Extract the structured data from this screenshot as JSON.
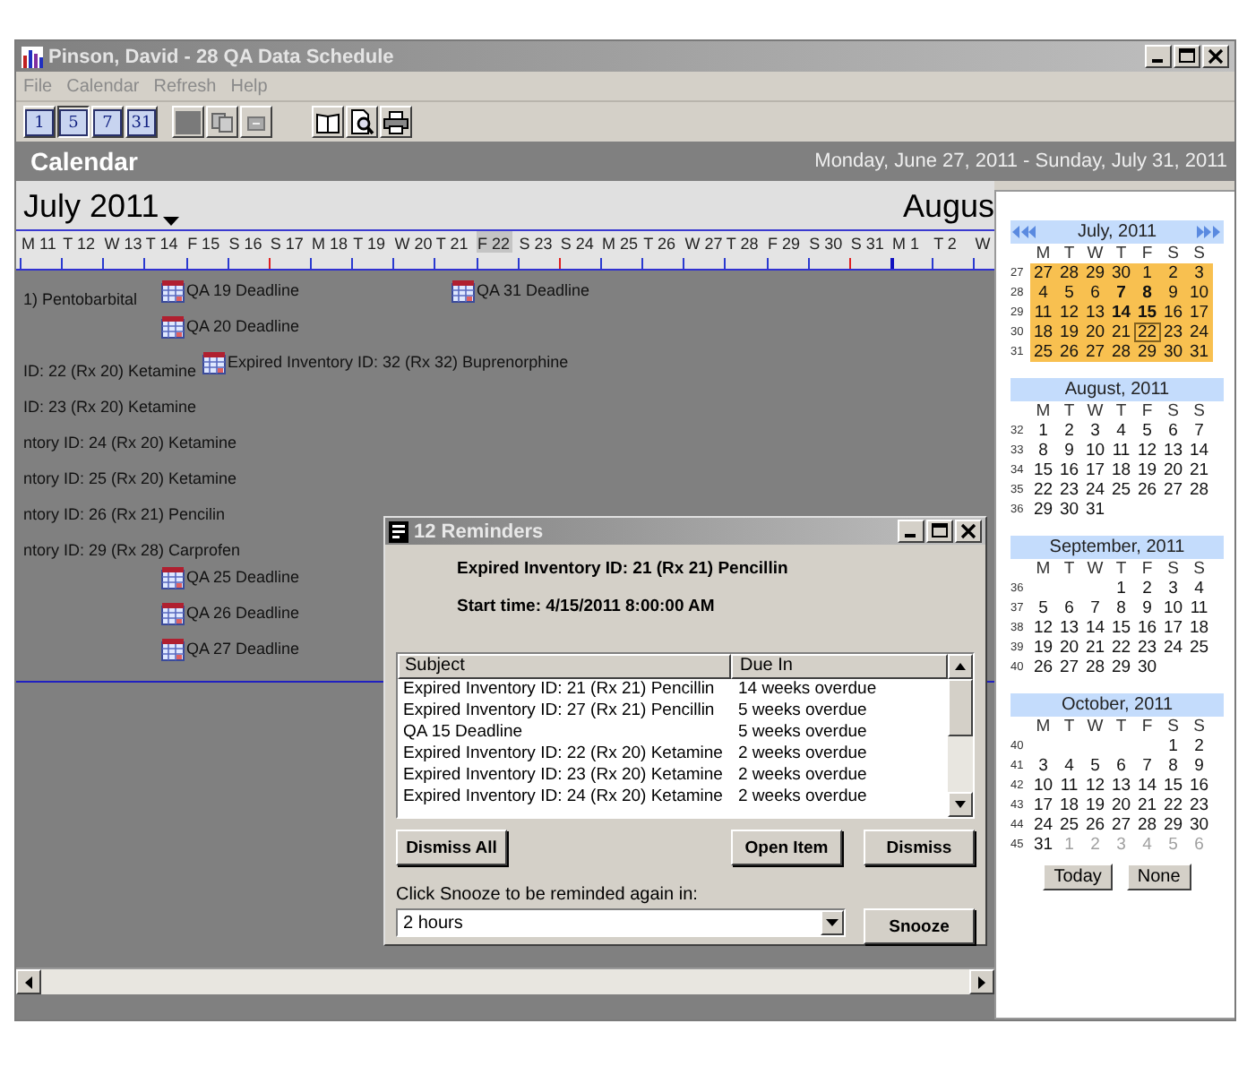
{
  "window": {
    "title": "Pinson, David - 28 QA Data Schedule"
  },
  "menu": [
    "File",
    "Calendar",
    "Refresh",
    "Help"
  ],
  "toolbar": {
    "view_buttons": [
      {
        "label": "1",
        "selected": false
      },
      {
        "label": "5",
        "selected": true
      },
      {
        "label": "7",
        "selected": false
      },
      {
        "label": "31",
        "selected": false
      }
    ]
  },
  "header": {
    "title": "Calendar",
    "range": "Monday, June 27, 2011 - Sunday, July 31, 2011"
  },
  "timeline": {
    "month": "July 2011",
    "next_month": "Augus",
    "days": [
      {
        "label": "M 11",
        "kind": "weekday",
        "selected": false
      },
      {
        "label": "T 12",
        "kind": "weekday",
        "selected": false
      },
      {
        "label": "W 13",
        "kind": "weekday",
        "selected": false
      },
      {
        "label": "T 14",
        "kind": "weekday",
        "selected": false
      },
      {
        "label": "F 15",
        "kind": "weekday",
        "selected": false
      },
      {
        "label": "S 16",
        "kind": "weekday",
        "selected": false
      },
      {
        "label": "S 17",
        "kind": "sunday",
        "selected": false
      },
      {
        "label": "M 18",
        "kind": "weekday",
        "selected": false
      },
      {
        "label": "T 19",
        "kind": "weekday",
        "selected": false
      },
      {
        "label": "W 20",
        "kind": "weekday",
        "selected": false
      },
      {
        "label": "T 21",
        "kind": "weekday",
        "selected": false
      },
      {
        "label": "F 22",
        "kind": "weekday",
        "selected": true
      },
      {
        "label": "S 23",
        "kind": "weekday",
        "selected": false
      },
      {
        "label": "S 24",
        "kind": "sunday",
        "selected": false
      },
      {
        "label": "M 25",
        "kind": "weekday",
        "selected": false
      },
      {
        "label": "T 26",
        "kind": "weekday",
        "selected": false
      },
      {
        "label": "W 27",
        "kind": "weekday",
        "selected": false
      },
      {
        "label": "T 28",
        "kind": "weekday",
        "selected": false
      },
      {
        "label": "F 29",
        "kind": "weekday",
        "selected": false
      },
      {
        "label": "S 30",
        "kind": "weekday",
        "selected": false
      },
      {
        "label": "S 31",
        "kind": "sunday",
        "selected": false
      },
      {
        "label": "M 1",
        "kind": "month_start",
        "selected": false
      },
      {
        "label": "T 2",
        "kind": "weekday",
        "selected": false
      },
      {
        "label": "W",
        "kind": "weekday",
        "selected": false
      }
    ],
    "rows": [
      {
        "events": [
          {
            "text": "1) Pentobarbital",
            "kind": "continued"
          },
          {
            "text": "QA 19 Deadline",
            "kind": "appointment"
          },
          {
            "text": "QA 31 Deadline",
            "kind": "appointment"
          }
        ]
      },
      {
        "events": [
          {
            "text": "QA 20 Deadline",
            "kind": "appointment"
          }
        ]
      },
      {
        "events": [
          {
            "text": "ID: 22 (Rx 20) Ketamine",
            "kind": "continued"
          },
          {
            "text": "Expired Inventory ID: 32 (Rx 32) Buprenorphine",
            "kind": "appointment"
          }
        ]
      },
      {
        "events": [
          {
            "text": "ID: 23 (Rx 20) Ketamine",
            "kind": "continued"
          }
        ]
      },
      {
        "events": [
          {
            "text": "ntory ID: 24 (Rx 20) Ketamine",
            "kind": "continued"
          }
        ]
      },
      {
        "events": [
          {
            "text": "ntory ID: 25 (Rx 20) Ketamine",
            "kind": "continued"
          }
        ]
      },
      {
        "events": [
          {
            "text": "ntory ID: 26 (Rx 21) Pencilin",
            "kind": "continued"
          }
        ]
      },
      {
        "events": [
          {
            "text": "ntory ID: 29 (Rx 28) Carprofen",
            "kind": "continued"
          }
        ]
      },
      {
        "events": [
          {
            "text": "QA 25 Deadline",
            "kind": "appointment"
          }
        ]
      },
      {
        "events": [
          {
            "text": "QA 26 Deadline",
            "kind": "appointment"
          }
        ]
      },
      {
        "events": [
          {
            "text": "QA 27 Deadline",
            "kind": "appointment"
          }
        ]
      }
    ]
  },
  "mini_calendar": {
    "months": [
      {
        "title": "July, 2011",
        "highlighted": true,
        "navigation": true,
        "weekdays": [
          "M",
          "T",
          "W",
          "T",
          "F",
          "S",
          "S"
        ],
        "weeks": [
          {
            "number": "27",
            "days": [
              {
                "day": "27",
                "kind": "normal"
              },
              {
                "day": "28",
                "kind": "normal"
              },
              {
                "day": "29",
                "kind": "normal"
              },
              {
                "day": "30",
                "kind": "normal"
              },
              {
                "day": "1",
                "kind": "normal"
              },
              {
                "day": "2",
                "kind": "normal"
              },
              {
                "day": "3",
                "kind": "normal"
              }
            ]
          },
          {
            "number": "28",
            "days": [
              {
                "day": "4",
                "kind": "normal"
              },
              {
                "day": "5",
                "kind": "normal"
              },
              {
                "day": "6",
                "kind": "normal"
              },
              {
                "day": "7",
                "kind": "bold"
              },
              {
                "day": "8",
                "kind": "bold"
              },
              {
                "day": "9",
                "kind": "normal"
              },
              {
                "day": "10",
                "kind": "normal"
              }
            ]
          },
          {
            "number": "29",
            "days": [
              {
                "day": "11",
                "kind": "normal"
              },
              {
                "day": "12",
                "kind": "normal"
              },
              {
                "day": "13",
                "kind": "normal"
              },
              {
                "day": "14",
                "kind": "bold"
              },
              {
                "day": "15",
                "kind": "bold"
              },
              {
                "day": "16",
                "kind": "normal"
              },
              {
                "day": "17",
                "kind": "normal"
              }
            ]
          },
          {
            "number": "30",
            "days": [
              {
                "day": "18",
                "kind": "normal"
              },
              {
                "day": "19",
                "kind": "normal"
              },
              {
                "day": "20",
                "kind": "normal"
              },
              {
                "day": "21",
                "kind": "normal"
              },
              {
                "day": "22",
                "kind": "today"
              },
              {
                "day": "23",
                "kind": "normal"
              },
              {
                "day": "24",
                "kind": "normal"
              }
            ]
          },
          {
            "number": "31",
            "days": [
              {
                "day": "25",
                "kind": "normal"
              },
              {
                "day": "26",
                "kind": "normal"
              },
              {
                "day": "27",
                "kind": "normal"
              },
              {
                "day": "28",
                "kind": "normal"
              },
              {
                "day": "29",
                "kind": "normal"
              },
              {
                "day": "30",
                "kind": "normal"
              },
              {
                "day": "31",
                "kind": "normal"
              }
            ]
          }
        ]
      },
      {
        "title": "August, 2011",
        "highlighted": false,
        "navigation": false,
        "weekdays": [
          "M",
          "T",
          "W",
          "T",
          "F",
          "S",
          "S"
        ],
        "weeks": [
          {
            "number": "32",
            "days": [
              {
                "day": "1",
                "kind": "normal"
              },
              {
                "day": "2",
                "kind": "normal"
              },
              {
                "day": "3",
                "kind": "normal"
              },
              {
                "day": "4",
                "kind": "normal"
              },
              {
                "day": "5",
                "kind": "normal"
              },
              {
                "day": "6",
                "kind": "normal"
              },
              {
                "day": "7",
                "kind": "normal"
              }
            ]
          },
          {
            "number": "33",
            "days": [
              {
                "day": "8",
                "kind": "normal"
              },
              {
                "day": "9",
                "kind": "normal"
              },
              {
                "day": "10",
                "kind": "normal"
              },
              {
                "day": "11",
                "kind": "normal"
              },
              {
                "day": "12",
                "kind": "normal"
              },
              {
                "day": "13",
                "kind": "normal"
              },
              {
                "day": "14",
                "kind": "normal"
              }
            ]
          },
          {
            "number": "34",
            "days": [
              {
                "day": "15",
                "kind": "normal"
              },
              {
                "day": "16",
                "kind": "normal"
              },
              {
                "day": "17",
                "kind": "normal"
              },
              {
                "day": "18",
                "kind": "normal"
              },
              {
                "day": "19",
                "kind": "normal"
              },
              {
                "day": "20",
                "kind": "normal"
              },
              {
                "day": "21",
                "kind": "normal"
              }
            ]
          },
          {
            "number": "35",
            "days": [
              {
                "day": "22",
                "kind": "normal"
              },
              {
                "day": "23",
                "kind": "normal"
              },
              {
                "day": "24",
                "kind": "normal"
              },
              {
                "day": "25",
                "kind": "normal"
              },
              {
                "day": "26",
                "kind": "normal"
              },
              {
                "day": "27",
                "kind": "normal"
              },
              {
                "day": "28",
                "kind": "normal"
              }
            ]
          },
          {
            "number": "36",
            "days": [
              {
                "day": "29",
                "kind": "normal"
              },
              {
                "day": "30",
                "kind": "normal"
              },
              {
                "day": "31",
                "kind": "normal"
              }
            ]
          }
        ]
      },
      {
        "title": "September, 2011",
        "highlighted": false,
        "navigation": false,
        "weekdays": [
          "M",
          "T",
          "W",
          "T",
          "F",
          "S",
          "S"
        ],
        "weeks": [
          {
            "number": "36",
            "days": [
              {
                "day": "1",
                "kind": "normal"
              },
              {
                "day": "2",
                "kind": "normal"
              },
              {
                "day": "3",
                "kind": "normal"
              },
              {
                "day": "4",
                "kind": "normal"
              }
            ]
          },
          {
            "number": "37",
            "days": [
              {
                "day": "5",
                "kind": "normal"
              },
              {
                "day": "6",
                "kind": "normal"
              },
              {
                "day": "7",
                "kind": "normal"
              },
              {
                "day": "8",
                "kind": "normal"
              },
              {
                "day": "9",
                "kind": "normal"
              },
              {
                "day": "10",
                "kind": "normal"
              },
              {
                "day": "11",
                "kind": "normal"
              }
            ]
          },
          {
            "number": "38",
            "days": [
              {
                "day": "12",
                "kind": "normal"
              },
              {
                "day": "13",
                "kind": "normal"
              },
              {
                "day": "14",
                "kind": "normal"
              },
              {
                "day": "15",
                "kind": "normal"
              },
              {
                "day": "16",
                "kind": "normal"
              },
              {
                "day": "17",
                "kind": "normal"
              },
              {
                "day": "18",
                "kind": "normal"
              }
            ]
          },
          {
            "number": "39",
            "days": [
              {
                "day": "19",
                "kind": "normal"
              },
              {
                "day": "20",
                "kind": "normal"
              },
              {
                "day": "21",
                "kind": "normal"
              },
              {
                "day": "22",
                "kind": "normal"
              },
              {
                "day": "23",
                "kind": "normal"
              },
              {
                "day": "24",
                "kind": "normal"
              },
              {
                "day": "25",
                "kind": "normal"
              }
            ]
          },
          {
            "number": "40",
            "days": [
              {
                "day": "26",
                "kind": "normal"
              },
              {
                "day": "27",
                "kind": "normal"
              },
              {
                "day": "28",
                "kind": "normal"
              },
              {
                "day": "29",
                "kind": "normal"
              },
              {
                "day": "30",
                "kind": "normal"
              }
            ]
          }
        ]
      },
      {
        "title": "October, 2011",
        "highlighted": false,
        "navigation": false,
        "weekdays": [
          "M",
          "T",
          "W",
          "T",
          "F",
          "S",
          "S"
        ],
        "weeks": [
          {
            "number": "40",
            "days": [
              {
                "day": "1",
                "kind": "normal"
              },
              {
                "day": "2",
                "kind": "normal"
              }
            ]
          },
          {
            "number": "41",
            "days": [
              {
                "day": "3",
                "kind": "normal"
              },
              {
                "day": "4",
                "kind": "normal"
              },
              {
                "day": "5",
                "kind": "normal"
              },
              {
                "day": "6",
                "kind": "normal"
              },
              {
                "day": "7",
                "kind": "normal"
              },
              {
                "day": "8",
                "kind": "normal"
              },
              {
                "day": "9",
                "kind": "normal"
              }
            ]
          },
          {
            "number": "42",
            "days": [
              {
                "day": "10",
                "kind": "normal"
              },
              {
                "day": "11",
                "kind": "normal"
              },
              {
                "day": "12",
                "kind": "normal"
              },
              {
                "day": "13",
                "kind": "normal"
              },
              {
                "day": "14",
                "kind": "normal"
              },
              {
                "day": "15",
                "kind": "normal"
              },
              {
                "day": "16",
                "kind": "normal"
              }
            ]
          },
          {
            "number": "43",
            "days": [
              {
                "day": "17",
                "kind": "normal"
              },
              {
                "day": "18",
                "kind": "normal"
              },
              {
                "day": "19",
                "kind": "normal"
              },
              {
                "day": "20",
                "kind": "normal"
              },
              {
                "day": "21",
                "kind": "normal"
              },
              {
                "day": "22",
                "kind": "normal"
              },
              {
                "day": "23",
                "kind": "normal"
              }
            ]
          },
          {
            "number": "44",
            "days": [
              {
                "day": "24",
                "kind": "normal"
              },
              {
                "day": "25",
                "kind": "normal"
              },
              {
                "day": "26",
                "kind": "normal"
              },
              {
                "day": "27",
                "kind": "normal"
              },
              {
                "day": "28",
                "kind": "normal"
              },
              {
                "day": "29",
                "kind": "normal"
              },
              {
                "day": "30",
                "kind": "normal"
              }
            ]
          },
          {
            "number": "45",
            "days": [
              {
                "day": "31",
                "kind": "normal"
              },
              {
                "day": "1",
                "kind": "other"
              },
              {
                "day": "2",
                "kind": "other"
              },
              {
                "day": "3",
                "kind": "other"
              },
              {
                "day": "4",
                "kind": "other"
              },
              {
                "day": "5",
                "kind": "other"
              },
              {
                "day": "6",
                "kind": "other"
              }
            ]
          }
        ]
      }
    ],
    "buttons": [
      "Today",
      "None"
    ]
  },
  "reminders": {
    "title": "12 Reminders",
    "subject": "Expired Inventory ID: 21 (Rx 21) Pencillin",
    "start": "Start time:  4/15/2011 8:00:00 AM",
    "columns": [
      "Subject",
      "Due In"
    ],
    "rows": [
      {
        "subject": "Expired Inventory ID: 21 (Rx 21) Pencillin",
        "due": "14 weeks overdue"
      },
      {
        "subject": "Expired Inventory ID: 27 (Rx 21) Pencillin",
        "due": "5 weeks overdue"
      },
      {
        "subject": "QA 15 Deadline",
        "due": "5 weeks overdue"
      },
      {
        "subject": "Expired Inventory ID: 22 (Rx 20) Ketamine",
        "due": "2 weeks overdue"
      },
      {
        "subject": "Expired Inventory ID: 23 (Rx 20) Ketamine",
        "due": "2 weeks overdue"
      },
      {
        "subject": "Expired Inventory ID: 24 (Rx 20) Ketamine",
        "due": "2 weeks overdue"
      }
    ],
    "buttons": [
      "Dismiss All",
      "Open Item",
      "Dismiss"
    ],
    "snooze_label": "Click Snooze to be reminded again in:",
    "snooze_value": "2 hours",
    "snooze_button": "Snooze"
  }
}
